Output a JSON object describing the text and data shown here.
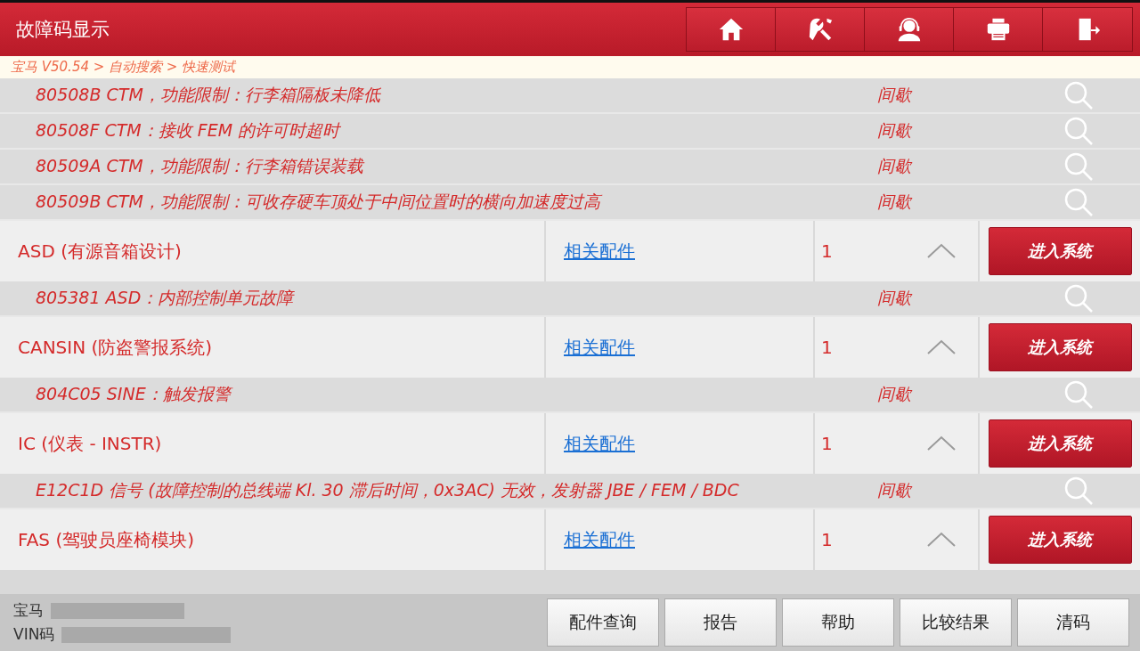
{
  "header": {
    "title": "故障码显示",
    "toolbar": [
      {
        "kind": "home"
      },
      {
        "kind": "tools"
      },
      {
        "kind": "support"
      },
      {
        "kind": "print"
      },
      {
        "kind": "exit"
      }
    ]
  },
  "breadcrumb": "宝马 V50.54 > 自动搜索 > 快速测试",
  "entries": [
    {
      "kind": "fault",
      "text": "80508B CTM，功能限制：行李箱隔板未降低",
      "status": "间歇"
    },
    {
      "kind": "fault",
      "text": "80508F CTM：接收 FEM 的许可时超时",
      "status": "间歇"
    },
    {
      "kind": "fault",
      "text": "80509A CTM，功能限制：行李箱错误装载",
      "status": "间歇"
    },
    {
      "kind": "fault",
      "text": "80509B CTM，功能限制：可收存硬车顶处于中间位置时的横向加速度过高",
      "status": "间歇"
    },
    {
      "kind": "module",
      "name": "ASD (有源音箱设计)",
      "link": "相关配件",
      "count": "1",
      "expanded": true,
      "button": "进入系统"
    },
    {
      "kind": "fault",
      "text": "805381 ASD：内部控制单元故障",
      "status": "间歇"
    },
    {
      "kind": "module",
      "name": "CANSIN (防盗警报系统)",
      "link": "相关配件",
      "count": "1",
      "expanded": true,
      "button": "进入系统"
    },
    {
      "kind": "fault",
      "text": "804C05 SINE：触发报警",
      "status": "间歇"
    },
    {
      "kind": "module",
      "name": "IC (仪表 - INSTR)",
      "link": "相关配件",
      "count": "1",
      "expanded": true,
      "button": "进入系统"
    },
    {
      "kind": "fault",
      "text": "E12C1D 信号 (故障控制的总线端 Kl. 30 滞后时间，0x3AC) 无效，发射器 JBE / FEM / BDC",
      "status": "间歇"
    },
    {
      "kind": "module",
      "name": "FAS (驾驶员座椅模块)",
      "link": "相关配件",
      "count": "1",
      "expanded": true,
      "button": "进入系统"
    }
  ],
  "footer": {
    "vehicle_label": "宝马",
    "vin_label": "VIN码",
    "buttons": [
      "配件查询",
      "报告",
      "帮助",
      "比较结果",
      "清码"
    ]
  }
}
